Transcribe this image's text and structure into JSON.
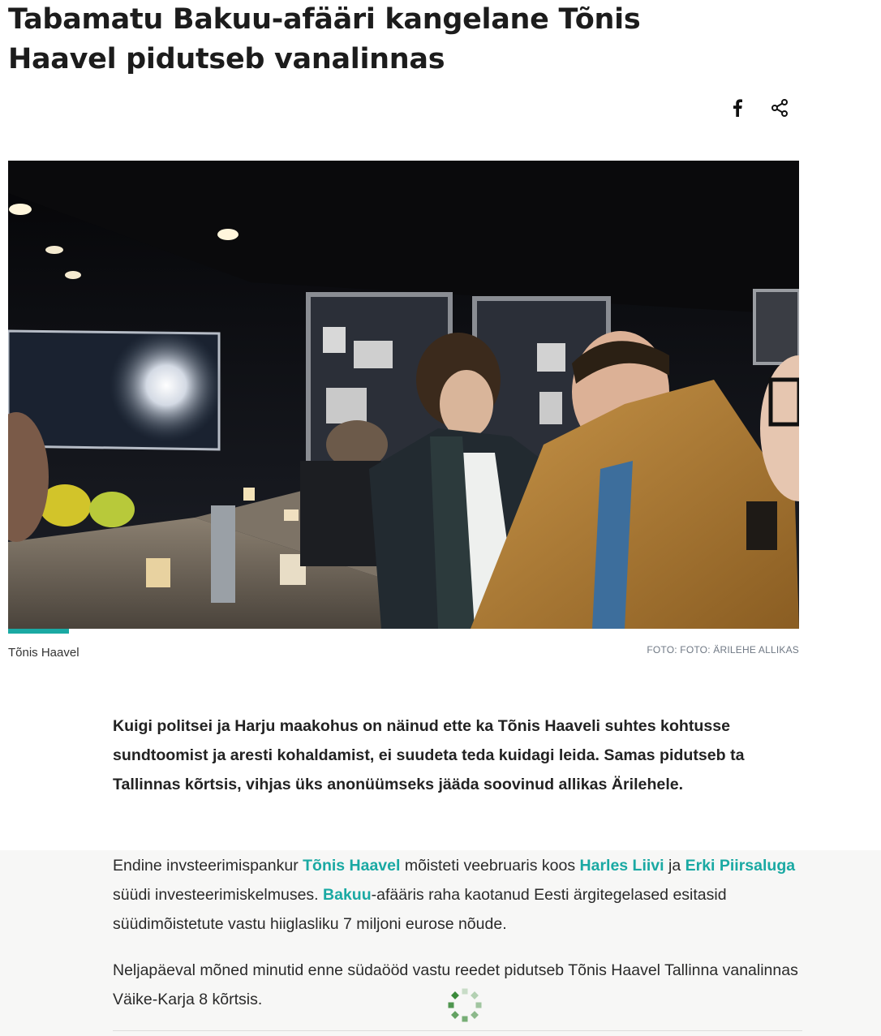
{
  "article": {
    "title": "Tabamatu Bakuu-afääri kangelane Tõnis Haavel pidutseb vanalinnas",
    "lead": "Kuigi politsei ja Harju maakohus on näinud ette ka Tõnis Haaveli suhtes kohtusse sundtoomist ja aresti kohaldamist, ei suudeta teda kuidagi leida. Samas pidutseb ta Tallinnas kõrtsis, vihjas üks anonüümseks jääda soovinud allikas Ärilehele."
  },
  "share": {
    "facebook_icon": "facebook-icon",
    "share_icon": "share-icon"
  },
  "photo": {
    "caption": "Tõnis Haavel",
    "credit": "FOTO: FOTO: ÄRILEHE ALLIKAS"
  },
  "body": {
    "p1": {
      "t1": "Endine invsteerimispankur ",
      "link1": "Tõnis Haavel",
      "t2": " mõisteti veebruaris koos ",
      "link2": "Harles Liivi",
      "t3": " ja ",
      "link3": "Erki Piirsaluga",
      "t4": " süüdi investeerimiskelmuses. ",
      "link4": "Bakuu",
      "t5": "-afääris raha kaotanud Eesti ärgitegelased esitasid süüdimõistetute vastu hiiglasliku 7 miljoni eurose nõude."
    },
    "p2": "Neljapäeval mõned minutid enne südaööd vastu reedet pidutseb Tõnis Haavel Tallinna vanalinnas Väike-Karja 8 kõrtsis."
  },
  "colors": {
    "accent": "#1aa9a3",
    "spinner": "#3a8a3a"
  },
  "loading_icon": "loading-spinner-icon"
}
